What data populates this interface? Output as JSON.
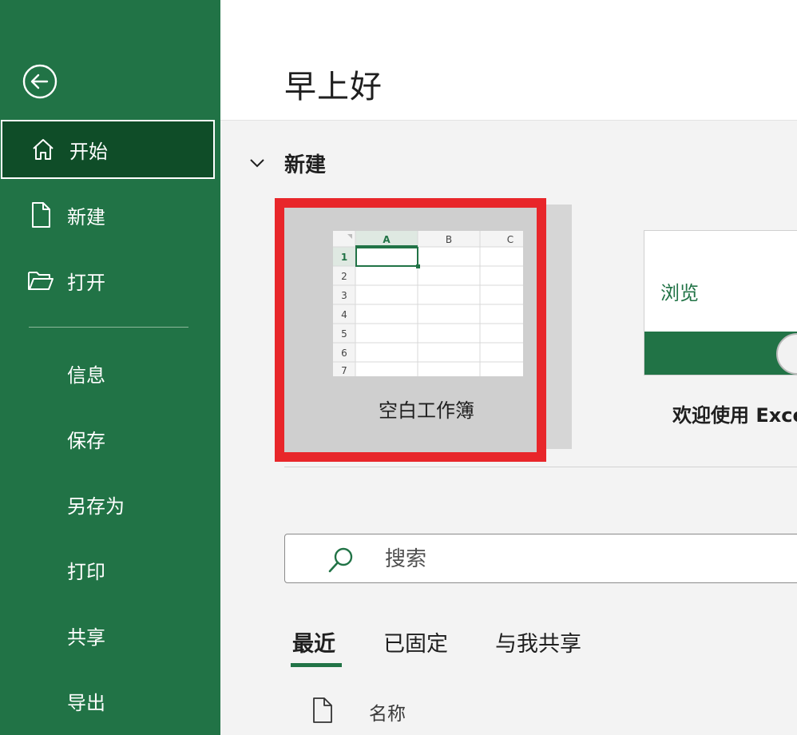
{
  "sidebar": {
    "primary": [
      {
        "label": "开始",
        "icon": "home-icon",
        "active": true
      },
      {
        "label": "新建",
        "icon": "new-document-icon",
        "active": false
      },
      {
        "label": "打开",
        "icon": "open-folder-icon",
        "active": false
      }
    ],
    "secondary": [
      "信息",
      "保存",
      "另存为",
      "打印",
      "共享",
      "导出"
    ]
  },
  "main": {
    "greeting": "早上好",
    "section_title": "新建",
    "templates": [
      {
        "label": "空白工作簿",
        "highlighted": true
      },
      {
        "label": "欢迎使用 Exce",
        "browse_text": "浏览"
      }
    ],
    "blank_thumb": {
      "columns": [
        "A",
        "B",
        "C"
      ],
      "rows": [
        "1",
        "2",
        "3",
        "4",
        "5",
        "6",
        "7"
      ]
    },
    "search": {
      "placeholder": "搜索"
    },
    "tabs": [
      {
        "label": "最近",
        "active": true
      },
      {
        "label": "已固定",
        "active": false
      },
      {
        "label": "与我共享",
        "active": false
      }
    ],
    "file_list": {
      "name_header": "名称"
    }
  },
  "colors": {
    "excel_green": "#217346",
    "active_nav": "#0f4d28",
    "highlight_red": "#e8262a"
  }
}
